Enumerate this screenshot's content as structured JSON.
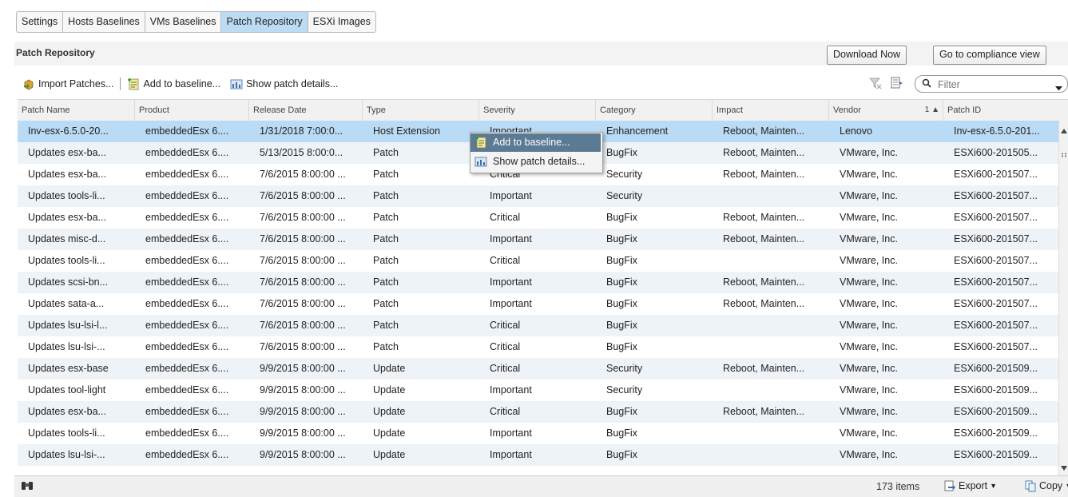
{
  "tabs": [
    {
      "label": "Settings",
      "active": false
    },
    {
      "label": "Hosts Baselines",
      "active": false
    },
    {
      "label": "VMs Baselines",
      "active": false
    },
    {
      "label": "Patch Repository",
      "active": true
    },
    {
      "label": "ESXi Images",
      "active": false
    }
  ],
  "panel": {
    "title": "Patch Repository",
    "download_now": "Download Now",
    "go_to_compliance": "Go to compliance view"
  },
  "toolbar": {
    "import_patches": "Import Patches...",
    "add_to_baseline": "Add to baseline...",
    "show_patch_details": "Show patch details...",
    "filter_placeholder": "Filter"
  },
  "columns": [
    "Patch Name",
    "Product",
    "Release Date",
    "Type",
    "Severity",
    "Category",
    "Impact",
    "Vendor",
    "Patch ID"
  ],
  "sort_indicator": "1 ▲",
  "rows": [
    [
      "Inv-esx-6.5.0-20...",
      "embeddedEsx 6....",
      "1/31/2018 7:00:0...",
      "Host Extension",
      "Important",
      "Enhancement",
      "Reboot, Mainten...",
      "Lenovo",
      "Inv-esx-6.5.0-201..."
    ],
    [
      "Updates esx-ba...",
      "embeddedEsx 6....",
      "5/13/2015 8:00:0...",
      "Patch",
      "Critical",
      "BugFix",
      "Reboot, Mainten...",
      "VMware, Inc.",
      "ESXi600-201505..."
    ],
    [
      "Updates esx-ba...",
      "embeddedEsx 6....",
      "7/6/2015 8:00:00 ...",
      "Patch",
      "Critical",
      "Security",
      "Reboot, Mainten...",
      "VMware, Inc.",
      "ESXi600-201507..."
    ],
    [
      "Updates tools-li...",
      "embeddedEsx 6....",
      "7/6/2015 8:00:00 ...",
      "Patch",
      "Important",
      "Security",
      "",
      "VMware, Inc.",
      "ESXi600-201507..."
    ],
    [
      "Updates esx-ba...",
      "embeddedEsx 6....",
      "7/6/2015 8:00:00 ...",
      "Patch",
      "Critical",
      "BugFix",
      "Reboot, Mainten...",
      "VMware, Inc.",
      "ESXi600-201507..."
    ],
    [
      "Updates misc-d...",
      "embeddedEsx 6....",
      "7/6/2015 8:00:00 ...",
      "Patch",
      "Important",
      "BugFix",
      "Reboot, Mainten...",
      "VMware, Inc.",
      "ESXi600-201507..."
    ],
    [
      "Updates tools-li...",
      "embeddedEsx 6....",
      "7/6/2015 8:00:00 ...",
      "Patch",
      "Critical",
      "BugFix",
      "",
      "VMware, Inc.",
      "ESXi600-201507..."
    ],
    [
      "Updates scsi-bn...",
      "embeddedEsx 6....",
      "7/6/2015 8:00:00 ...",
      "Patch",
      "Important",
      "BugFix",
      "Reboot, Mainten...",
      "VMware, Inc.",
      "ESXi600-201507..."
    ],
    [
      "Updates sata-a...",
      "embeddedEsx 6....",
      "7/6/2015 8:00:00 ...",
      "Patch",
      "Important",
      "BugFix",
      "Reboot, Mainten...",
      "VMware, Inc.",
      "ESXi600-201507..."
    ],
    [
      "Updates lsu-lsi-l...",
      "embeddedEsx 6....",
      "7/6/2015 8:00:00 ...",
      "Patch",
      "Critical",
      "BugFix",
      "",
      "VMware, Inc.",
      "ESXi600-201507..."
    ],
    [
      "Updates lsu-lsi-...",
      "embeddedEsx 6....",
      "7/6/2015 8:00:00 ...",
      "Patch",
      "Critical",
      "BugFix",
      "",
      "VMware, Inc.",
      "ESXi600-201507..."
    ],
    [
      "Updates esx-base",
      "embeddedEsx 6....",
      "9/9/2015 8:00:00 ...",
      "Update",
      "Critical",
      "Security",
      "Reboot, Mainten...",
      "VMware, Inc.",
      "ESXi600-201509..."
    ],
    [
      "Updates tool-light",
      "embeddedEsx 6....",
      "9/9/2015 8:00:00 ...",
      "Update",
      "Important",
      "Security",
      "",
      "VMware, Inc.",
      "ESXi600-201509..."
    ],
    [
      "Updates esx-ba...",
      "embeddedEsx 6....",
      "9/9/2015 8:00:00 ...",
      "Update",
      "Critical",
      "BugFix",
      "Reboot, Mainten...",
      "VMware, Inc.",
      "ESXi600-201509..."
    ],
    [
      "Updates tools-li...",
      "embeddedEsx 6....",
      "9/9/2015 8:00:00 ...",
      "Update",
      "Important",
      "BugFix",
      "",
      "VMware, Inc.",
      "ESXi600-201509..."
    ],
    [
      "Updates lsu-lsi-...",
      "embeddedEsx 6....",
      "9/9/2015 8:00:00 ...",
      "Update",
      "Important",
      "BugFix",
      "",
      "VMware, Inc.",
      "ESXi600-201509..."
    ]
  ],
  "selected_row": 0,
  "context_menu": {
    "add_to_baseline": "Add to baseline...",
    "show_patch_details": "Show patch details..."
  },
  "footer": {
    "count": "173 items",
    "export": "Export",
    "copy": "Copy"
  },
  "colors": {
    "selected_row": "#b9dbf5",
    "alt_row": "#eef3f8",
    "active_tab": "#bcdcf4",
    "menu_highlight": "#5b7a94"
  }
}
